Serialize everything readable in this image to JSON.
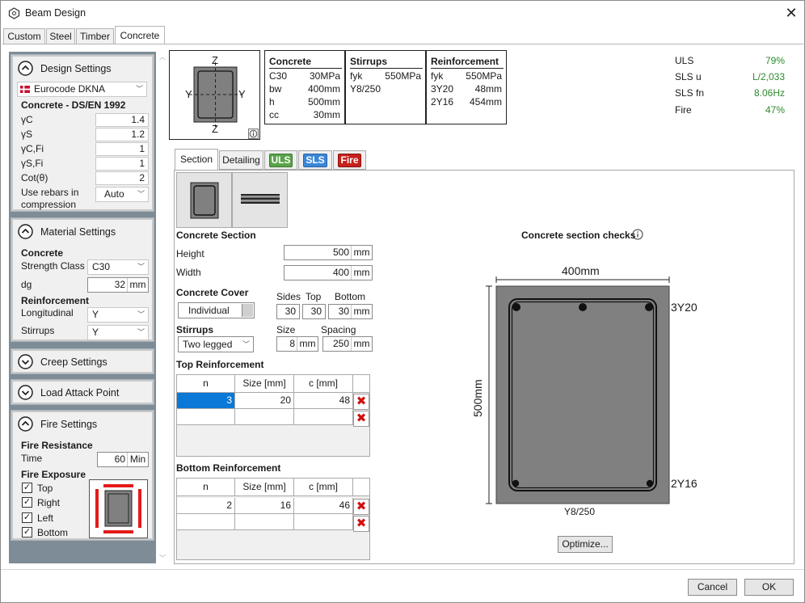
{
  "window": {
    "title": "Beam Design"
  },
  "top_tabs": [
    "Custom",
    "Steel",
    "Timber",
    "Concrete"
  ],
  "design_settings": {
    "title": "Design Settings",
    "code": "Eurocode DKNA",
    "standard_heading": "Concrete - DS/EN 1992",
    "rows": [
      {
        "label": "γC",
        "value": "1.4"
      },
      {
        "label": "γS",
        "value": "1.2"
      },
      {
        "label": "γC,Fi",
        "value": "1"
      },
      {
        "label": "γS,Fi",
        "value": "1"
      },
      {
        "label": "Cot(θ)",
        "value": "2"
      }
    ],
    "rebar_compression_label_1": "Use rebars in",
    "rebar_compression_label_2": "compression",
    "rebar_compression_value": "Auto"
  },
  "material_settings": {
    "title": "Material Settings",
    "concrete_heading": "Concrete",
    "strength_label": "Strength Class",
    "strength_value": "C30",
    "dg_label": "dg",
    "dg_value": "32",
    "dg_unit": "mm",
    "reinforcement_heading": "Reinforcement",
    "longitudinal_label": "Longitudinal",
    "longitudinal_value": "Y",
    "stirrups_label": "Stirrups",
    "stirrups_value": "Y"
  },
  "creep_settings": {
    "title": "Creep Settings"
  },
  "load_attack": {
    "title": "Load Attack Point"
  },
  "fire_settings": {
    "title": "Fire Settings",
    "resistance_heading": "Fire Resistance",
    "time_label": "Time",
    "time_value": "60",
    "time_unit": "Min",
    "exposure_heading": "Fire Exposure",
    "exposures": [
      "Top",
      "Right",
      "Left",
      "Bottom"
    ]
  },
  "summary": {
    "axis_z": "Z",
    "axis_y": "Y",
    "concrete": {
      "title": "Concrete",
      "rows": [
        [
          "C30",
          "30MPa"
        ],
        [
          "bw",
          "400mm"
        ],
        [
          "h",
          "500mm"
        ],
        [
          "cc",
          "30mm"
        ]
      ]
    },
    "stirrups": {
      "title": "Stirrups",
      "rows": [
        [
          "fyk",
          "550MPa"
        ],
        [
          "Y8/250",
          ""
        ]
      ]
    },
    "reinforcement": {
      "title": "Reinforcement",
      "rows": [
        [
          "fyk",
          "550MPa"
        ],
        [
          "3Y20",
          "48mm"
        ],
        [
          "2Y16",
          "454mm"
        ]
      ]
    }
  },
  "status": [
    {
      "label": "ULS",
      "value": "79%"
    },
    {
      "label": "SLS u",
      "value": "L/2,033"
    },
    {
      "label": "SLS fn",
      "value": "8.06Hz"
    },
    {
      "label": "Fire",
      "value": "47%"
    }
  ],
  "inner_tabs": [
    "Section",
    "Detailing",
    "ULS",
    "SLS",
    "Fire"
  ],
  "section": {
    "concrete_section_heading": "Concrete Section",
    "height_label": "Height",
    "height_value": "500",
    "height_unit": "mm",
    "width_label": "Width",
    "width_value": "400",
    "width_unit": "mm",
    "cover_heading": "Concrete Cover",
    "cover_mode": "Individual",
    "sides_label": "Sides",
    "sides_value": "30",
    "top_label": "Top",
    "top_value": "30",
    "bottom_label": "Bottom",
    "bottom_value": "30",
    "bottom_unit": "mm",
    "stirrups_heading": "Stirrups",
    "stirrups_type": "Two legged",
    "size_label": "Size",
    "size_value": "8",
    "size_unit": "mm",
    "spacing_label": "Spacing",
    "spacing_value": "250",
    "spacing_unit": "mm",
    "top_reinf_heading": "Top Reinforcement",
    "bottom_reinf_heading": "Bottom Reinforcement",
    "col_headers": [
      "n",
      "Size [mm]",
      "c [mm]"
    ],
    "top_rows": [
      [
        "3",
        "20",
        "48"
      ]
    ],
    "bottom_rows": [
      [
        "2",
        "16",
        "46"
      ]
    ]
  },
  "checks": {
    "title": "Concrete section checks",
    "width_dim": "400mm",
    "height_dim": "500mm",
    "top_label": "3Y20",
    "bottom_label": "2Y16",
    "stirrup_label": "Y8/250",
    "optimize_label": "Optimize..."
  },
  "footer": {
    "cancel": "Cancel",
    "ok": "OK"
  }
}
